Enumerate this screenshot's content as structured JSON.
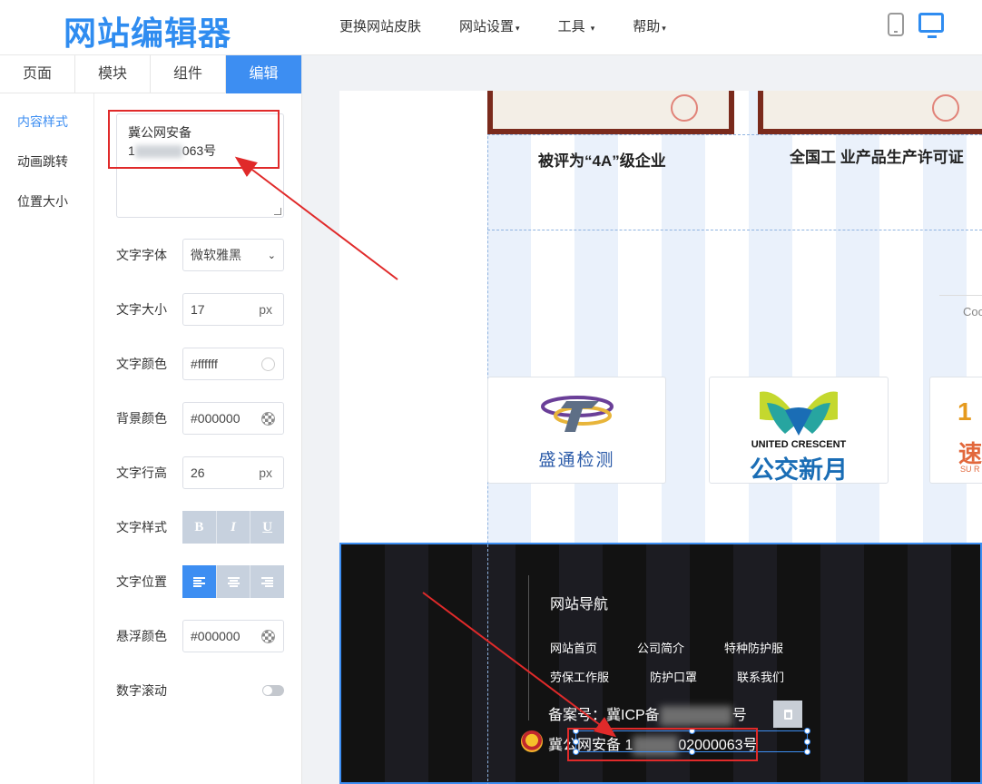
{
  "app": {
    "logo": "网站编辑器",
    "nav": [
      {
        "label": "更换网站皮肤",
        "caret": ""
      },
      {
        "label": "网站设置",
        "caret": "▾"
      },
      {
        "label": "工具",
        "caret": "▾"
      },
      {
        "label": "帮助",
        "caret": "▾"
      }
    ],
    "colors": {
      "accent": "#3d8ef2",
      "annotation": "#e02a2a"
    }
  },
  "panel": {
    "tabs": [
      "页面",
      "模块",
      "组件",
      "编辑"
    ],
    "active_tab": "编辑",
    "subnav": [
      "内容样式",
      "动画跳转",
      "位置大小"
    ],
    "content_text_line1": "冀公网安备",
    "content_text_line2_prefix": "1",
    "content_text_line2_suffix": "063号",
    "fields": {
      "font": {
        "label": "文字字体",
        "value": "微软雅黑"
      },
      "size": {
        "label": "文字大小",
        "value": "17",
        "unit": "px"
      },
      "color": {
        "label": "文字颜色",
        "value": "#ffffff"
      },
      "bg": {
        "label": "背景颜色",
        "value": "#000000"
      },
      "line_height": {
        "label": "文字行高",
        "value": "26",
        "unit": "px"
      },
      "style": {
        "label": "文字样式",
        "buttons": [
          "B",
          "I",
          "U"
        ]
      },
      "align": {
        "label": "文字位置"
      },
      "hover": {
        "label": "悬浮颜色",
        "value": "#000000"
      },
      "scroll": {
        "label": "数字滚动",
        "enabled": false
      }
    }
  },
  "canvas": {
    "captions": [
      "被评为“4A”级企业",
      "全国工 业产品生产许可证"
    ],
    "partner_text": "Coo",
    "partners": [
      {
        "name": "盛通检测"
      },
      {
        "name_en": "UNITED CRESCENT",
        "name": "公交新月"
      },
      {
        "name": "速",
        "sub": "SU R"
      }
    ],
    "footer": {
      "nav_title": "网站导航",
      "links_row1": [
        "网站首页",
        "公司简介",
        "特种防护服"
      ],
      "links_row2": [
        "劳保工作服",
        "防护口罩",
        "联系我们"
      ],
      "icp_prefix": "备案号：冀ICP备",
      "icp_suffix": "号",
      "police_prefix": "冀公网安备 1",
      "police_suffix": "02000063号"
    }
  }
}
